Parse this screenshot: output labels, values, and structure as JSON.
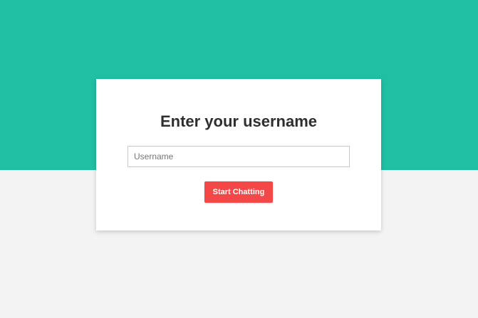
{
  "colors": {
    "accent_band": "#1fbfa2",
    "background": "#f3f3f3",
    "card": "#ffffff",
    "button": "#f44848"
  },
  "login_card": {
    "title": "Enter your username",
    "username_placeholder": "Username",
    "username_value": "",
    "submit_label": "Start Chatting"
  }
}
